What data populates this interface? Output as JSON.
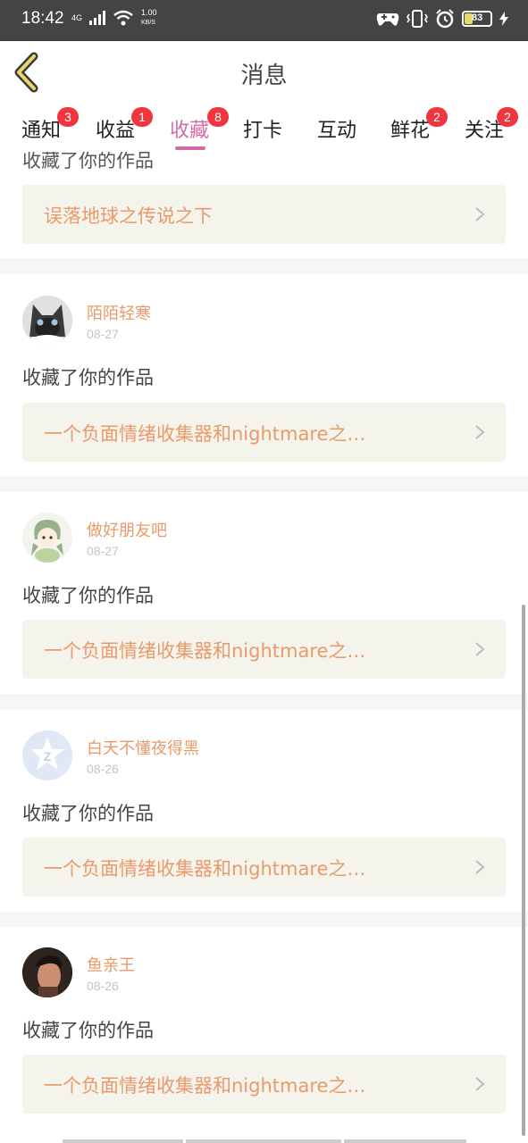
{
  "status": {
    "time": "18:42",
    "net": "4G",
    "speed_value": "1.00",
    "speed_unit": "KB/S",
    "battery": "83"
  },
  "header": {
    "title": "消息"
  },
  "tabs": [
    {
      "label": "通知",
      "badge": "3"
    },
    {
      "label": "收益",
      "badge": "1"
    },
    {
      "label": "收藏",
      "badge": "8"
    },
    {
      "label": "打卡",
      "badge": ""
    },
    {
      "label": "互动",
      "badge": ""
    },
    {
      "label": "鲜花",
      "badge": "2"
    },
    {
      "label": "关注",
      "badge": "2"
    }
  ],
  "active_tab": "收藏",
  "partial_item": {
    "action": "收藏了你的作品",
    "work": "误落地球之传说之下"
  },
  "items": [
    {
      "user": "陌陌轻寒",
      "date": "08-27",
      "action": "收藏了你的作品",
      "work": "一个负面情绪收集器和nightmare之…"
    },
    {
      "user": "做好朋友吧",
      "date": "08-27",
      "action": "收藏了你的作品",
      "work": "一个负面情绪收集器和nightmare之…"
    },
    {
      "user": "白天不懂夜得黑",
      "date": "08-26",
      "action": "收藏了你的作品",
      "work": "一个负面情绪收集器和nightmare之…"
    },
    {
      "user": "鱼亲王",
      "date": "08-26",
      "action": "收藏了你的作品",
      "work": "一个负面情绪收集器和nightmare之…"
    }
  ],
  "colors": {
    "accent": "#d46ba8",
    "link": "#e99a6a",
    "badge": "#f0353e"
  }
}
